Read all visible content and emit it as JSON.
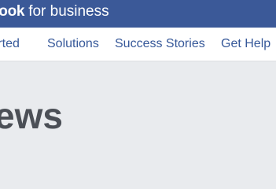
{
  "header": {
    "brand_bold": "book",
    "brand_suffix": "for business"
  },
  "nav": {
    "items": [
      {
        "label": "tarted"
      },
      {
        "label": "Solutions"
      },
      {
        "label": "Success Stories"
      },
      {
        "label": "Get Help"
      }
    ]
  },
  "hero": {
    "title": "ews"
  },
  "colors": {
    "brand_bar": "#3b5998",
    "nav_link": "#365899",
    "page_bg": "#e9ebee",
    "title_text": "#4b4f56"
  }
}
